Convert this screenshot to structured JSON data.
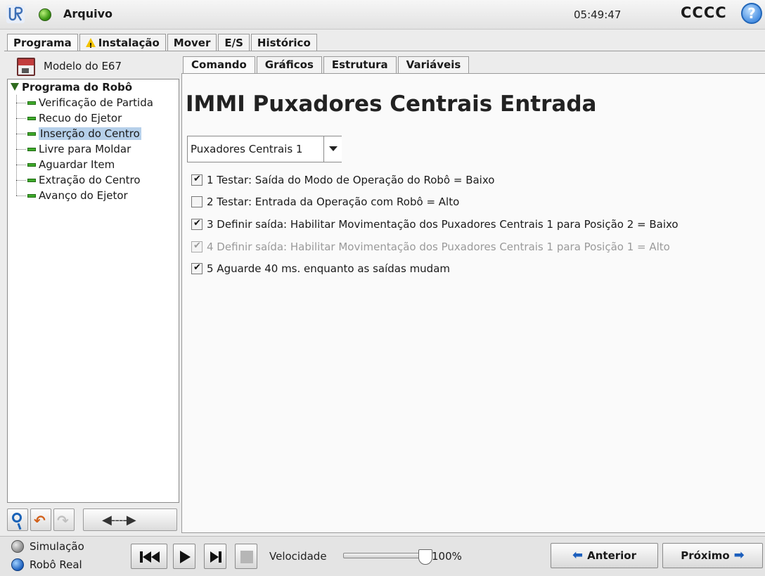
{
  "titlebar": {
    "file_menu": "Arquivo",
    "clock": "05:49:47",
    "robot_name": "CCCC",
    "help": "?"
  },
  "main_tabs": [
    "Programa",
    "Instalação",
    "Mover",
    "E/S",
    "Histórico"
  ],
  "left": {
    "program_name": "Modelo do E67",
    "tree_root": "Programa do Robô",
    "tree_items": [
      "Verificação de Partida",
      "Recuo do Ejetor",
      "Inserção do Centro",
      "Livre para Moldar",
      "Aguardar Item",
      "Extração do Centro",
      "Avanço do Ejetor"
    ],
    "selected_index": 2
  },
  "content_tabs": [
    "Comando",
    "Gráficos",
    "Estrutura",
    "Variáveis"
  ],
  "content": {
    "title": "IMMI Puxadores Centrais Entrada",
    "dropdown_value": "Puxadores Centrais 1",
    "commands": [
      {
        "text": "1 Testar: Saída do Modo de Operação do Robô = Baixo",
        "checked": true,
        "enabled": true
      },
      {
        "text": "2 Testar: Entrada da Operação com Robô = Alto",
        "checked": false,
        "enabled": true
      },
      {
        "text": "3 Definir saída: Habilitar Movimentação dos Puxadores Centrais 1 para Posição 2 = Baixo",
        "checked": true,
        "enabled": true
      },
      {
        "text": "4 Definir saída: Habilitar Movimentação dos Puxadores Centrais 1 para Posição 1 = Alto",
        "checked": true,
        "enabled": false
      },
      {
        "text": "5 Aguarde 40 ms. enquanto as saídas mudam",
        "checked": true,
        "enabled": true
      }
    ]
  },
  "bottom": {
    "mode_simulation": "Simulação",
    "mode_real": "Robô Real",
    "speed_label": "Velocidade",
    "speed_value": "100%",
    "speed_fraction": 1.0,
    "prev_label": "Anterior",
    "next_label": "Próximo"
  },
  "colors": {
    "status_green": "#3e9a16",
    "selection": "#b6d0ea",
    "accent_blue": "#1c5fbd",
    "warning": "#f2c200"
  }
}
